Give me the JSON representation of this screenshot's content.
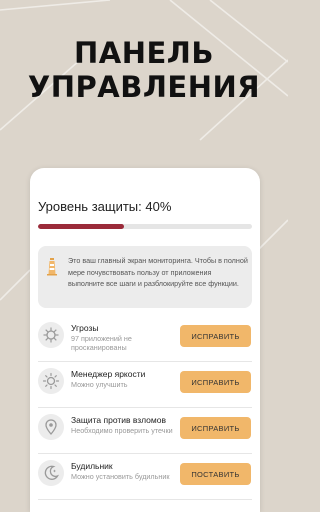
{
  "hero": {
    "line1": "ПАНЕЛЬ",
    "line2": "УПРАВЛЕНИЯ"
  },
  "colors": {
    "accent": "#f1b76a",
    "progress": "#9b2b3a",
    "background": "#dcd5cb"
  },
  "protection": {
    "label": "Уровень защиты: 40%",
    "percent": 40
  },
  "info": {
    "text": "Это ваш главный экран мониторинга. Чтобы в полной мере почувствовать пользу от приложения выполните все шаги и разблокируйте все функции.",
    "icon": "lighthouse-icon"
  },
  "rows": [
    {
      "icon": "virus-icon",
      "title": "Угрозы",
      "subtitle": "97 приложений не просканированы",
      "button": "ИСПРАВИТЬ"
    },
    {
      "icon": "sun-icon",
      "title": "Менеджер яркости",
      "subtitle": "Можно улучшить",
      "button": "ИСПРАВИТЬ"
    },
    {
      "icon": "location-pin-icon",
      "title": "Защита против взломов",
      "subtitle": "Необходимо проверить утечки",
      "button": "ИСПРАВИТЬ"
    },
    {
      "icon": "moon-icon",
      "title": "Будильник",
      "subtitle": "Можно установить будильник",
      "button": "ПОСТАВИТЬ"
    }
  ]
}
